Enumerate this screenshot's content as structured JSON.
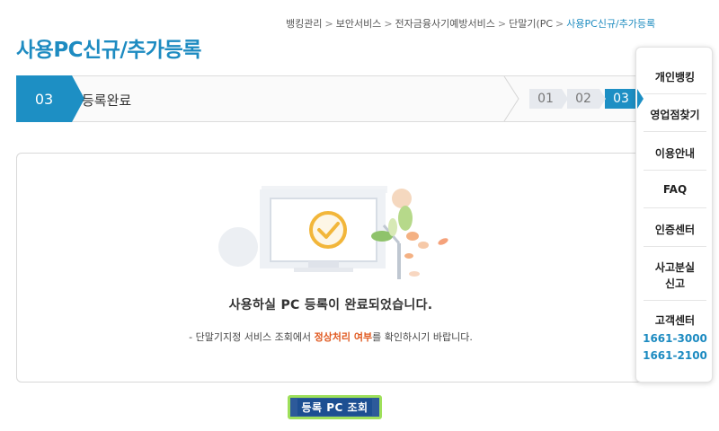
{
  "breadcrumb": {
    "items": [
      "뱅킹관리",
      "보안서비스",
      "전자금융사기예방서비스",
      "단말기(PC",
      "사용PC신규/추가등록"
    ],
    "separator": ">"
  },
  "page": {
    "title": "사용PC신규/추가등록"
  },
  "steps": {
    "current_number": "03",
    "current_label": "등록완료",
    "numbers": [
      "01",
      "02",
      "03"
    ],
    "active_index": 2
  },
  "result": {
    "main_message": "사용하실 PC 등록이 완료되었습니다.",
    "sub_prefix": "- 단말기지정 서비스 조회에서 ",
    "sub_highlight": "정상처리 여부",
    "sub_suffix": "를 확인하시기 바랍니다."
  },
  "actions": {
    "lookup_button": "등록 PC 조회"
  },
  "quick_menu": {
    "items": [
      "개인뱅킹",
      "영업점찾기",
      "이용안내",
      "FAQ",
      "인증센터"
    ],
    "loss_report": [
      "사고분실",
      "신고"
    ],
    "customer_center": "고객센터",
    "phones": [
      "1661-3000",
      "1661-2100"
    ]
  },
  "colors": {
    "accent": "#1d8fc4",
    "highlight": "#e05a21",
    "button": "#2d5a9a",
    "button_outline": "#9ee05a"
  }
}
